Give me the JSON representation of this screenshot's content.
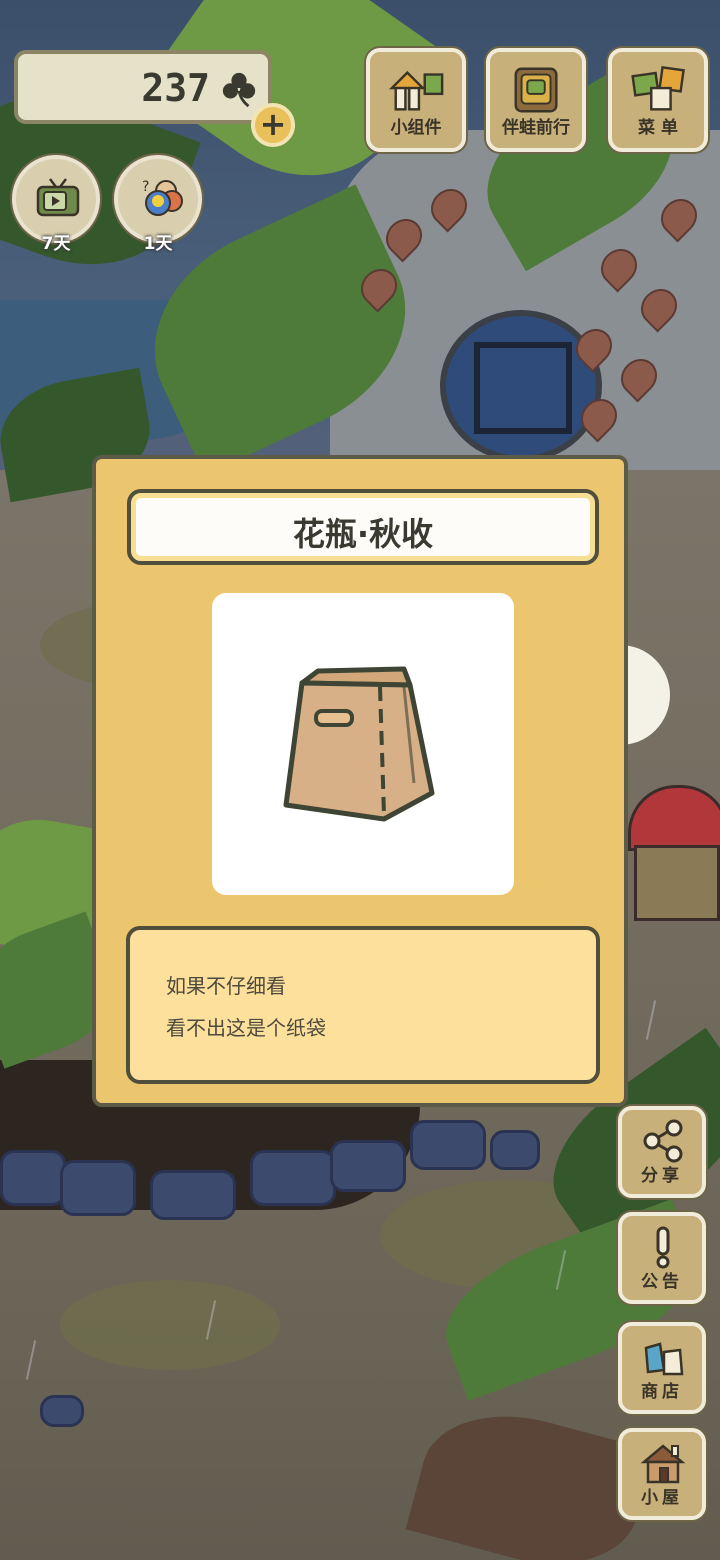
{
  "hud": {
    "clover_count": "237",
    "clover_icon": "clover-icon",
    "add_icon": "plus-icon"
  },
  "top_buttons": [
    {
      "label": "小组件",
      "icon": "widget-icon"
    },
    {
      "label": "伴蛙前行",
      "icon": "album-icon"
    },
    {
      "label": "菜 单",
      "icon": "menu-icon"
    }
  ],
  "round_buttons": [
    {
      "days": "7天",
      "icon": "tv-icon"
    },
    {
      "days": "1天",
      "icon": "bird-friends-icon"
    }
  ],
  "item": {
    "title": "花瓶·秋收",
    "art": "paper-bag-vase",
    "description": [
      "如果不仔细看",
      "看不出这是个纸袋"
    ]
  },
  "side_buttons": [
    {
      "label": "分享",
      "icon": "share-icon"
    },
    {
      "label": "公告",
      "icon": "notice-icon"
    },
    {
      "label": "商店",
      "icon": "shop-icon"
    },
    {
      "label": "小屋",
      "icon": "house-icon"
    }
  ],
  "colors": {
    "dialog_bg": "#ecc66e",
    "title_bg": "#fdfcf8",
    "desc_bg": "#fde09b",
    "button_wood": "#c8b07a",
    "outline": "#4f4f3c"
  }
}
